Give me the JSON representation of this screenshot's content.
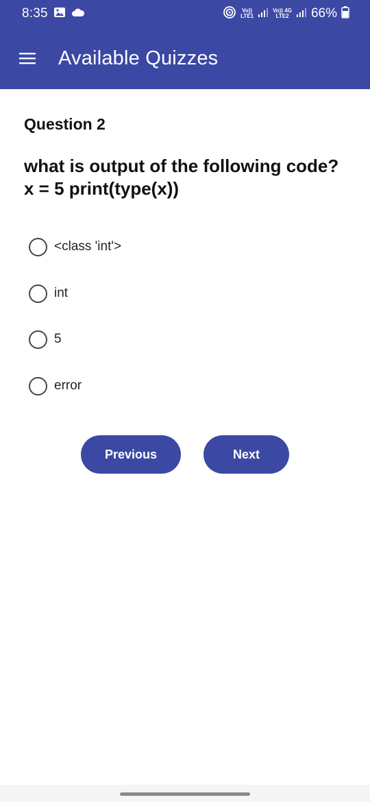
{
  "status_bar": {
    "time": "8:35",
    "sim1_top": "Vo))",
    "sim1_bottom": "LTE1",
    "sim2_top": "Vo)) 4G",
    "sim2_bottom": "LTE2",
    "battery": "66%",
    "icons": [
      "gallery-icon",
      "cloud-icon",
      "hotspot-icon",
      "signal-icon",
      "battery-icon"
    ]
  },
  "app_bar": {
    "title": "Available Quizzes",
    "menu_icon": "hamburger-menu-icon",
    "color": "#3b48a4"
  },
  "quiz": {
    "question_number": "Question 2",
    "question_line1": "what is output of the following code?",
    "question_line2": "x = 5 print(type(x))",
    "options": [
      {
        "label": "<class 'int'>",
        "selected": false
      },
      {
        "label": "int",
        "selected": false
      },
      {
        "label": "5",
        "selected": false
      },
      {
        "label": "error",
        "selected": false
      }
    ]
  },
  "buttons": {
    "previous": "Previous",
    "next": "Next"
  }
}
